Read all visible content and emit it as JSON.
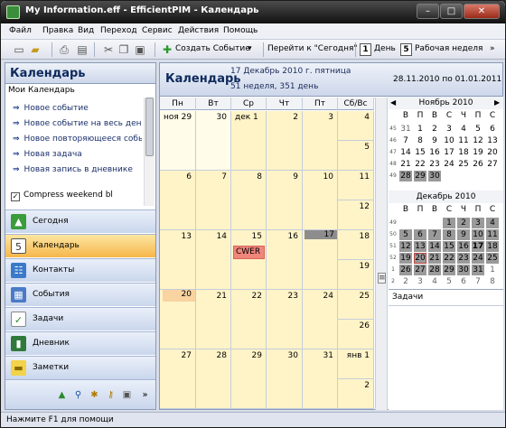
{
  "window": {
    "title": "My Information.eff - EfficientPIM - Календарь"
  },
  "menu": [
    "Файл",
    "Правка",
    "Вид",
    "Переход",
    "Сервис",
    "Действия",
    "Помощь"
  ],
  "toolbar": {
    "create_event": "Создать Событие",
    "goto_today": "Перейти к \"Сегодня\"",
    "day_num": "1",
    "day_label": "День",
    "week_num": "5",
    "week_label": "Рабочая неделя"
  },
  "left": {
    "title": "Календарь",
    "subtitle": "Мои Календарь",
    "tasks": [
      "Новое событие",
      "Новое событие на весь день",
      "Новое повторяющееся событие",
      "Новая задача",
      "Новая запись в дневнике"
    ],
    "compress": "Compress weekend bl",
    "nav": [
      {
        "label": "Сегодня",
        "icon": "today-icon"
      },
      {
        "label": "Календарь",
        "icon": "calendar-icon"
      },
      {
        "label": "Контакты",
        "icon": "contacts-icon"
      },
      {
        "label": "События",
        "icon": "events-icon"
      },
      {
        "label": "Задачи",
        "icon": "tasks-icon"
      },
      {
        "label": "Дневник",
        "icon": "diary-icon"
      },
      {
        "label": "Заметки",
        "icon": "notes-icon"
      }
    ]
  },
  "calendar": {
    "title": "Календарь",
    "date": "17 Декабрь 2010 г. пятница",
    "week": "51 неделя, 351 день",
    "range": "28.11.2010 по 01.01.2011",
    "dow": [
      "Пн",
      "Вт",
      "Ср",
      "Чт",
      "Пт",
      "Сб/Вс"
    ],
    "weeks": [
      {
        "days": [
          "ноя 29",
          "30",
          "дек 1",
          "2",
          "3"
        ],
        "sat": "4",
        "sun": "5"
      },
      {
        "days": [
          "6",
          "7",
          "8",
          "9",
          "10"
        ],
        "sat": "11",
        "sun": "12"
      },
      {
        "days": [
          "13",
          "14",
          "15",
          "16",
          "17"
        ],
        "sat": "18",
        "sun": "19"
      },
      {
        "days": [
          "20",
          "21",
          "22",
          "23",
          "24"
        ],
        "sat": "25",
        "sun": "26"
      },
      {
        "days": [
          "27",
          "28",
          "29",
          "30",
          "31"
        ],
        "sat": "янв 1",
        "sun": "2"
      }
    ],
    "event": "CWER"
  },
  "minical": {
    "nov": {
      "title": "Ноябрь 2010",
      "dow": [
        "В",
        "П",
        "В",
        "С",
        "Ч",
        "П",
        "С"
      ],
      "weeks": [
        {
          "wk": "45",
          "days": [
            "31",
            "1",
            "2",
            "3",
            "4",
            "5",
            "6"
          ]
        },
        {
          "wk": "46",
          "days": [
            "7",
            "8",
            "9",
            "10",
            "11",
            "12",
            "13"
          ]
        },
        {
          "wk": "47",
          "days": [
            "14",
            "15",
            "16",
            "17",
            "18",
            "19",
            "20"
          ]
        },
        {
          "wk": "48",
          "days": [
            "21",
            "22",
            "23",
            "24",
            "25",
            "26",
            "27"
          ]
        },
        {
          "wk": "49",
          "days": [
            "28",
            "29",
            "30",
            "",
            "",
            "",
            ""
          ]
        }
      ]
    },
    "dec": {
      "title": "Декабрь 2010",
      "dow": [
        "В",
        "П",
        "В",
        "С",
        "Ч",
        "П",
        "С"
      ],
      "weeks": [
        {
          "wk": "49",
          "days": [
            "",
            "",
            "",
            "1",
            "2",
            "3",
            "4"
          ]
        },
        {
          "wk": "50",
          "days": [
            "5",
            "6",
            "7",
            "8",
            "9",
            "10",
            "11"
          ]
        },
        {
          "wk": "51",
          "days": [
            "12",
            "13",
            "14",
            "15",
            "16",
            "17",
            "18"
          ]
        },
        {
          "wk": "52",
          "days": [
            "19",
            "20",
            "21",
            "22",
            "23",
            "24",
            "25"
          ]
        },
        {
          "wk": "1",
          "days": [
            "26",
            "27",
            "28",
            "29",
            "30",
            "31",
            "1"
          ]
        },
        {
          "wk": "2",
          "days": [
            "2",
            "3",
            "4",
            "5",
            "6",
            "7",
            "8"
          ]
        }
      ]
    },
    "tasks_label": "Задачи"
  },
  "status": "Нажмите F1 для помощи"
}
